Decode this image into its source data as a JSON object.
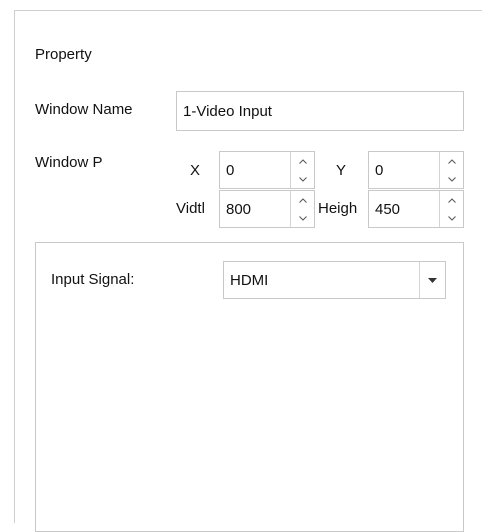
{
  "property_panel": {
    "title": "Property",
    "window_name_label": "Window Name",
    "window_name_value": "1-Video Input",
    "window_position_label": "Window P",
    "x_label": "X",
    "x_value": "0",
    "y_label": "Y",
    "y_value": "0",
    "width_label": "Vidtl",
    "width_value": "800",
    "height_label": "Heigh",
    "height_value": "450"
  },
  "input_group": {
    "input_signal_label": "Input Signal:",
    "input_signal_value": "HDMI"
  },
  "icons": {
    "spin_up": "spin-up-icon",
    "spin_down": "spin-down-icon",
    "dropdown": "chevron-down-icon"
  }
}
